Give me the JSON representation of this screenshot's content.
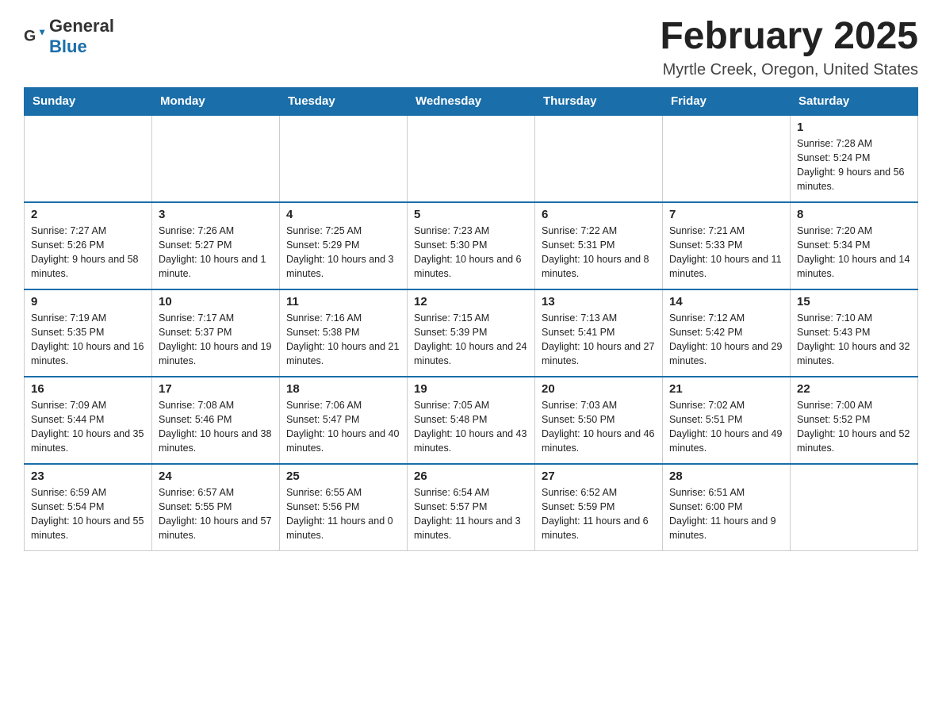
{
  "logo": {
    "general": "General",
    "blue": "Blue"
  },
  "header": {
    "title": "February 2025",
    "location": "Myrtle Creek, Oregon, United States"
  },
  "weekdays": [
    "Sunday",
    "Monday",
    "Tuesday",
    "Wednesday",
    "Thursday",
    "Friday",
    "Saturday"
  ],
  "weeks": [
    [
      {
        "day": "",
        "info": ""
      },
      {
        "day": "",
        "info": ""
      },
      {
        "day": "",
        "info": ""
      },
      {
        "day": "",
        "info": ""
      },
      {
        "day": "",
        "info": ""
      },
      {
        "day": "",
        "info": ""
      },
      {
        "day": "1",
        "info": "Sunrise: 7:28 AM\nSunset: 5:24 PM\nDaylight: 9 hours and 56 minutes."
      }
    ],
    [
      {
        "day": "2",
        "info": "Sunrise: 7:27 AM\nSunset: 5:26 PM\nDaylight: 9 hours and 58 minutes."
      },
      {
        "day": "3",
        "info": "Sunrise: 7:26 AM\nSunset: 5:27 PM\nDaylight: 10 hours and 1 minute."
      },
      {
        "day": "4",
        "info": "Sunrise: 7:25 AM\nSunset: 5:29 PM\nDaylight: 10 hours and 3 minutes."
      },
      {
        "day": "5",
        "info": "Sunrise: 7:23 AM\nSunset: 5:30 PM\nDaylight: 10 hours and 6 minutes."
      },
      {
        "day": "6",
        "info": "Sunrise: 7:22 AM\nSunset: 5:31 PM\nDaylight: 10 hours and 8 minutes."
      },
      {
        "day": "7",
        "info": "Sunrise: 7:21 AM\nSunset: 5:33 PM\nDaylight: 10 hours and 11 minutes."
      },
      {
        "day": "8",
        "info": "Sunrise: 7:20 AM\nSunset: 5:34 PM\nDaylight: 10 hours and 14 minutes."
      }
    ],
    [
      {
        "day": "9",
        "info": "Sunrise: 7:19 AM\nSunset: 5:35 PM\nDaylight: 10 hours and 16 minutes."
      },
      {
        "day": "10",
        "info": "Sunrise: 7:17 AM\nSunset: 5:37 PM\nDaylight: 10 hours and 19 minutes."
      },
      {
        "day": "11",
        "info": "Sunrise: 7:16 AM\nSunset: 5:38 PM\nDaylight: 10 hours and 21 minutes."
      },
      {
        "day": "12",
        "info": "Sunrise: 7:15 AM\nSunset: 5:39 PM\nDaylight: 10 hours and 24 minutes."
      },
      {
        "day": "13",
        "info": "Sunrise: 7:13 AM\nSunset: 5:41 PM\nDaylight: 10 hours and 27 minutes."
      },
      {
        "day": "14",
        "info": "Sunrise: 7:12 AM\nSunset: 5:42 PM\nDaylight: 10 hours and 29 minutes."
      },
      {
        "day": "15",
        "info": "Sunrise: 7:10 AM\nSunset: 5:43 PM\nDaylight: 10 hours and 32 minutes."
      }
    ],
    [
      {
        "day": "16",
        "info": "Sunrise: 7:09 AM\nSunset: 5:44 PM\nDaylight: 10 hours and 35 minutes."
      },
      {
        "day": "17",
        "info": "Sunrise: 7:08 AM\nSunset: 5:46 PM\nDaylight: 10 hours and 38 minutes."
      },
      {
        "day": "18",
        "info": "Sunrise: 7:06 AM\nSunset: 5:47 PM\nDaylight: 10 hours and 40 minutes."
      },
      {
        "day": "19",
        "info": "Sunrise: 7:05 AM\nSunset: 5:48 PM\nDaylight: 10 hours and 43 minutes."
      },
      {
        "day": "20",
        "info": "Sunrise: 7:03 AM\nSunset: 5:50 PM\nDaylight: 10 hours and 46 minutes."
      },
      {
        "day": "21",
        "info": "Sunrise: 7:02 AM\nSunset: 5:51 PM\nDaylight: 10 hours and 49 minutes."
      },
      {
        "day": "22",
        "info": "Sunrise: 7:00 AM\nSunset: 5:52 PM\nDaylight: 10 hours and 52 minutes."
      }
    ],
    [
      {
        "day": "23",
        "info": "Sunrise: 6:59 AM\nSunset: 5:54 PM\nDaylight: 10 hours and 55 minutes."
      },
      {
        "day": "24",
        "info": "Sunrise: 6:57 AM\nSunset: 5:55 PM\nDaylight: 10 hours and 57 minutes."
      },
      {
        "day": "25",
        "info": "Sunrise: 6:55 AM\nSunset: 5:56 PM\nDaylight: 11 hours and 0 minutes."
      },
      {
        "day": "26",
        "info": "Sunrise: 6:54 AM\nSunset: 5:57 PM\nDaylight: 11 hours and 3 minutes."
      },
      {
        "day": "27",
        "info": "Sunrise: 6:52 AM\nSunset: 5:59 PM\nDaylight: 11 hours and 6 minutes."
      },
      {
        "day": "28",
        "info": "Sunrise: 6:51 AM\nSunset: 6:00 PM\nDaylight: 11 hours and 9 minutes."
      },
      {
        "day": "",
        "info": ""
      }
    ]
  ]
}
